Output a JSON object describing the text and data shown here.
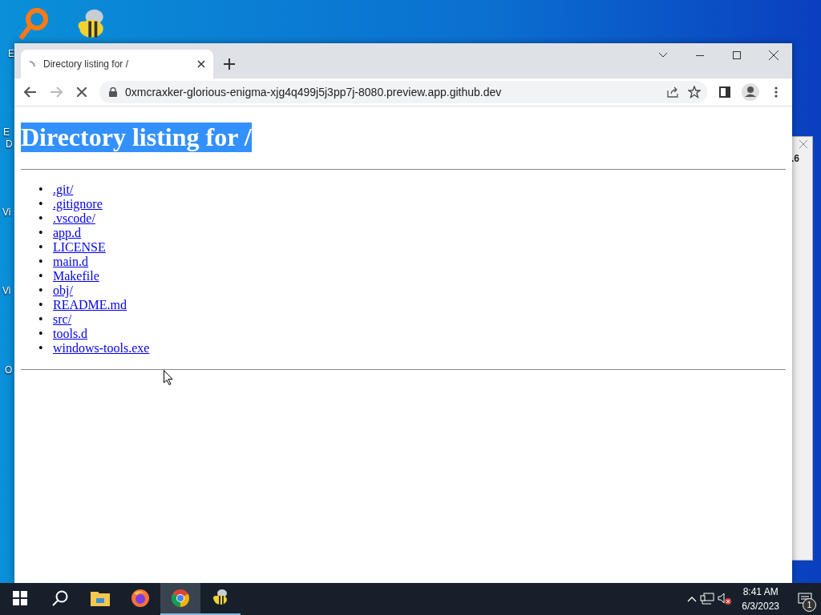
{
  "desktop": {
    "icon_labels": [
      {
        "text": "E"
      },
      {
        "text": "E"
      },
      {
        "text": "D"
      },
      {
        "text": "Vi"
      },
      {
        "text": "Vi"
      },
      {
        "text": "O"
      }
    ]
  },
  "background_window": {
    "version_text": ".6"
  },
  "browser": {
    "tab": {
      "title": "Directory listing for /",
      "loading": true
    },
    "toolbar": {
      "forward_disabled": true,
      "loading": true,
      "url": "0xmcraxker-glorious-enigma-xjg4q499j5j3pp7j-8080.preview.app.github.dev"
    },
    "page": {
      "heading": "Directory listing for /",
      "heading_selected": true,
      "entries": [
        {
          "bullet": "•",
          "name": ".git/"
        },
        {
          "bullet": "•",
          "name": ".gitignore"
        },
        {
          "bullet": "•",
          "name": ".vscode/"
        },
        {
          "bullet": "•",
          "name": "app.d"
        },
        {
          "bullet": "•",
          "name": "LICENSE"
        },
        {
          "bullet": "•",
          "name": "main.d"
        },
        {
          "bullet": "•",
          "name": "Makefile"
        },
        {
          "bullet": "•",
          "name": "obj/"
        },
        {
          "bullet": "•",
          "name": "README.md"
        },
        {
          "bullet": "•",
          "name": "src/"
        },
        {
          "bullet": "•",
          "name": "tools.d"
        },
        {
          "bullet": "•",
          "name": "windows-tools.exe"
        }
      ]
    }
  },
  "taskbar": {
    "apps": [
      {
        "kind": "explorer",
        "selected": false,
        "running": false
      },
      {
        "kind": "firefox",
        "selected": false,
        "running": false
      },
      {
        "kind": "chrome",
        "selected": true,
        "running": true
      },
      {
        "kind": "bee",
        "selected": false,
        "running": true
      }
    ],
    "time": "8:41 AM",
    "date": "6/3/2023",
    "notifications": "1"
  }
}
